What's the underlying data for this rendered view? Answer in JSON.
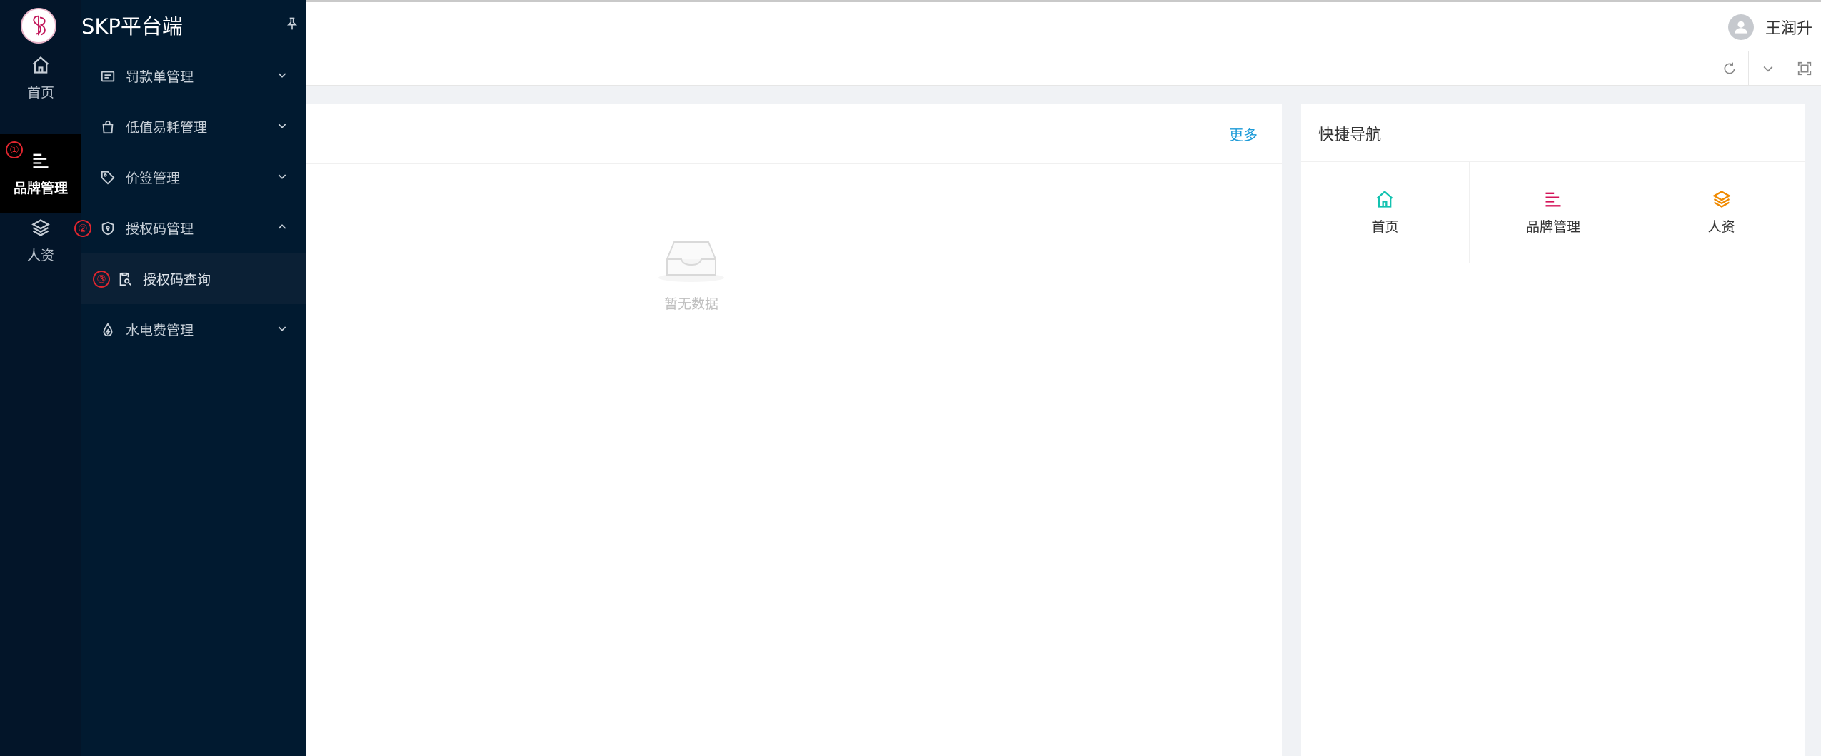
{
  "app": {
    "title": "SKP平台端"
  },
  "user": {
    "name": "王润升"
  },
  "sidebar": {
    "items": [
      {
        "label": "首页",
        "icon": "home-icon"
      },
      {
        "label": "品牌管理",
        "icon": "list-align-icon",
        "active": true
      },
      {
        "label": "人资",
        "icon": "layers-icon"
      }
    ]
  },
  "flyout": {
    "menu": [
      {
        "label": "罚款单管理",
        "icon": "form-card-icon",
        "expanded": false
      },
      {
        "label": "低值易耗管理",
        "icon": "shopping-bag-icon",
        "expanded": false
      },
      {
        "label": "价签管理",
        "icon": "price-tag-icon",
        "expanded": false
      },
      {
        "label": "授权码管理",
        "icon": "shield-icon",
        "expanded": true
      },
      {
        "label": "授权码查询",
        "icon": "document-search-icon",
        "sub": true
      },
      {
        "label": "水电费管理",
        "icon": "water-drop-icon",
        "expanded": false
      }
    ]
  },
  "main": {
    "left_card": {
      "more_label": "更多",
      "empty_text": "暂无数据"
    },
    "quick_nav": {
      "title": "快捷导航",
      "items": [
        {
          "label": "首页",
          "icon": "home-icon",
          "color": "#13c2b0"
        },
        {
          "label": "品牌管理",
          "icon": "list-align-icon",
          "color": "#d4145a"
        },
        {
          "label": "人资",
          "icon": "layers-icon",
          "color": "#f08a00"
        }
      ]
    }
  },
  "annotations": [
    "①",
    "②",
    "③"
  ],
  "colors": {
    "sidebar_bg": "#031529",
    "flyout_bg": "#011a30",
    "active_bg": "#000000",
    "link": "#1d9bd8",
    "annotation": "#e0262f"
  }
}
